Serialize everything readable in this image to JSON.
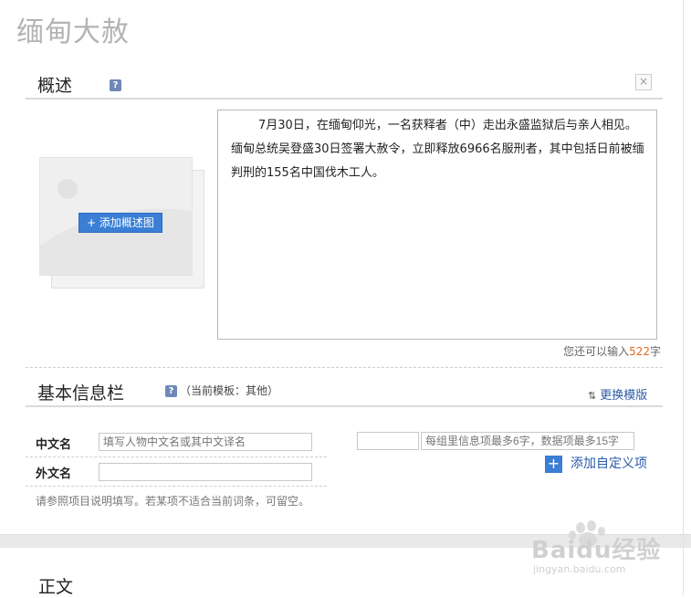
{
  "page_title": "缅甸大赦",
  "overview": {
    "title": "概述",
    "help": "?",
    "close": "×",
    "add_image_label": "+ 添加概述图",
    "text": "7月30日，在缅甸仰光，一名获释者（中）走出永盛监狱后与亲人相见。缅甸总统吴登盛30日签署大赦令，立即释放6966名服刑者，其中包括日前被缅判刑的155名中国伐木工人。",
    "counter_prefix": "您还可以输入",
    "counter_value": "522",
    "counter_suffix": "字"
  },
  "infobox": {
    "title": "基本信息栏",
    "help": "?",
    "template_note": "（当前模板：其他）",
    "swap_template": "更换模版",
    "cn_name_label": "中文名",
    "cn_name_placeholder": "填写人物中文名或其中文译名",
    "foreign_name_label": "外文名",
    "foreign_name_placeholder": "",
    "custom_key_placeholder": "",
    "custom_value_placeholder": "每组里信息项最多6字，数据项最多15字",
    "add_custom": "添加自定义项",
    "hint": "请参照项目说明填写。若某项不适合当前词条，可留空。"
  },
  "body_section": {
    "title": "正文"
  },
  "watermark": {
    "brand": "Baidu经验",
    "url": "jingyan.baidu.com"
  },
  "colors": {
    "accent": "#3a7fd5",
    "link": "#2a5aa8",
    "counter": "#e06a1c"
  }
}
